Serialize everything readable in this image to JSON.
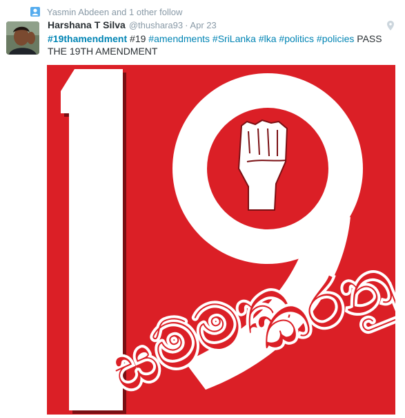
{
  "context": {
    "icon": "follow-icon",
    "text": "Yasmin Abdeen and 1 other follow"
  },
  "tweet": {
    "avatar_icon": "avatar-photo",
    "fullname": "Harshana T Silva",
    "username": "@thushara93",
    "separator": "·",
    "time": "Apr 23",
    "pin_icon": "location-pin-icon",
    "text_parts": {
      "hashtag1": "#19thamendment",
      "plain1": " #19 ",
      "hashtag2": "#amendments",
      "sp1": " ",
      "hashtag3": "#SriLanka",
      "sp2": " ",
      "hashtag4": "#lka",
      "sp3": " ",
      "hashtag5": "#politics",
      "sp4": " ",
      "hashtag6": "#policies",
      "plain2": " PASS THE 19TH AMENDMENT"
    },
    "media": {
      "big_number": "19",
      "sinhala_line1": "සම්මත",
      "sinhala_line2": "කරනු",
      "background_color": "#db1f26",
      "number_color": "#ffffff"
    }
  },
  "colors": {
    "link": "#0084b4",
    "muted": "#8899a6",
    "text": "#292f33",
    "follow_icon": "#55acee"
  }
}
